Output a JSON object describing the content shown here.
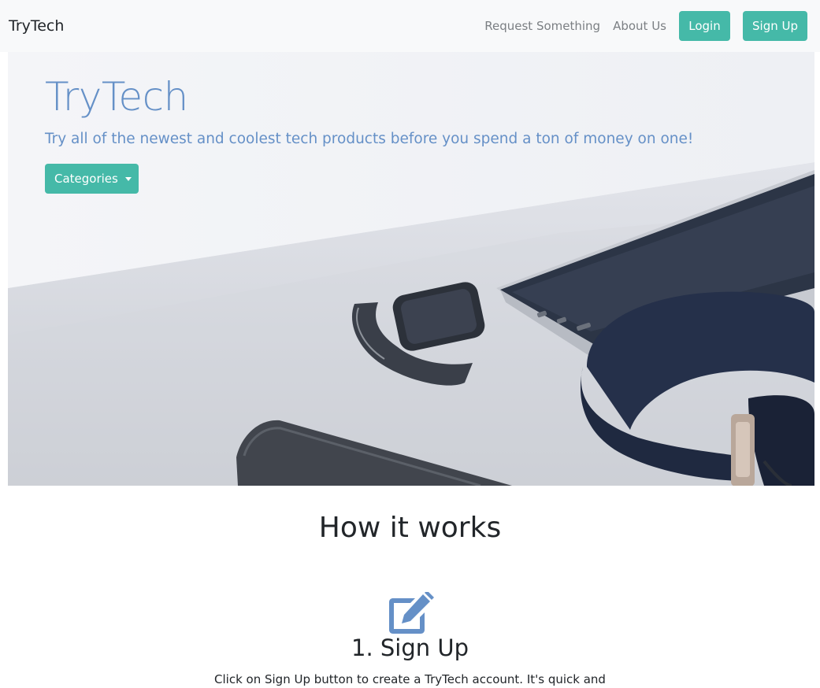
{
  "navbar": {
    "brand": "TryTech",
    "links": [
      "Request Something",
      "About Us"
    ],
    "login_label": "Login",
    "signup_label": "Sign Up"
  },
  "hero": {
    "title": "TryTech",
    "lead": "Try all of the newest and coolest tech products before you spend a ton of money on one!",
    "categories_label": "Categories"
  },
  "how_it_works": {
    "title": "How it works",
    "steps": [
      {
        "icon": "edit-icon",
        "title": "1. Sign Up",
        "description": "Click on Sign Up button to create a TryTech account. It's quick and"
      }
    ]
  },
  "colors": {
    "accent": "#45b9a8",
    "hero_text": "#6590c7",
    "navbar_bg": "#f8f9fa"
  }
}
